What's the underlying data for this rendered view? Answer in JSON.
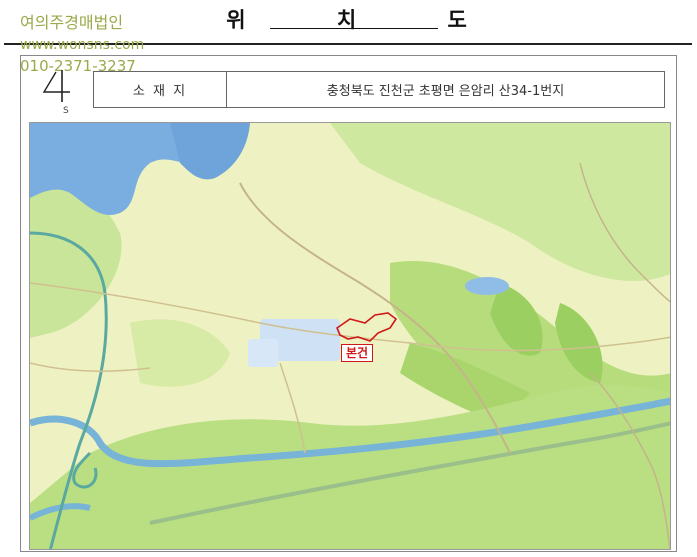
{
  "title": "위 치 도",
  "watermark": {
    "company": "여의주경매법인",
    "website": "www.wonsns.com",
    "phone": "010-2371-3237"
  },
  "north_arrow": {
    "letter": "S"
  },
  "location_table": {
    "label": "소 재 지",
    "address": "충청북도 진천군 초평면 은암리 산34-1번지"
  },
  "map": {
    "marker_label": "본건",
    "colors": {
      "water": "#7aaee0",
      "forest": "#b8df7a",
      "land": "#f0f3c4",
      "urban": "#cfe1f5",
      "road": "#9bbf8a",
      "marker": "#d01818"
    }
  }
}
